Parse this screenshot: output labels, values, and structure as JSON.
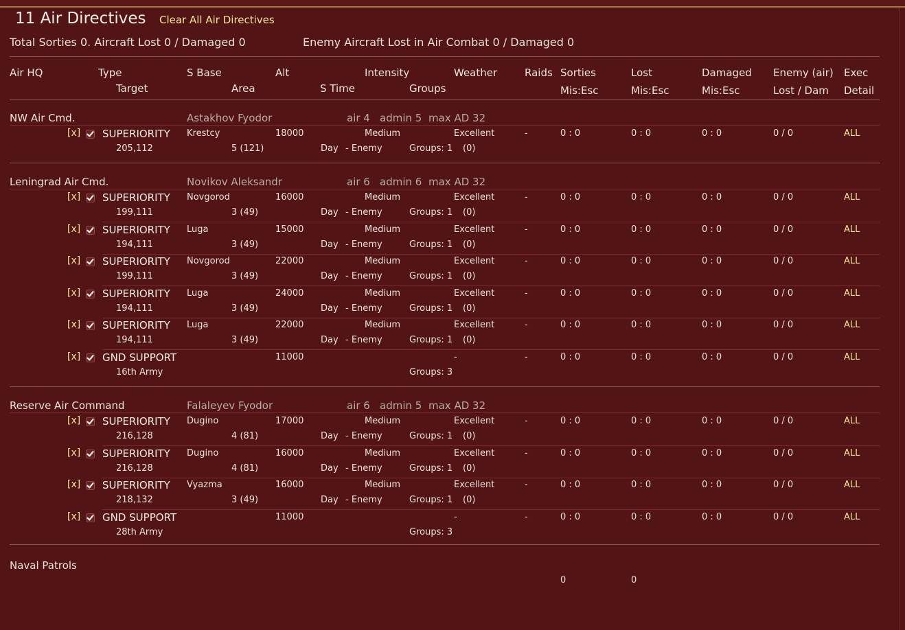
{
  "header": {
    "title": "11 Air Directives",
    "clear_link": "Clear All Air Directives",
    "summary_left": "Total Sorties 0. Aircraft Lost 0 / Damaged 0",
    "summary_right": "Enemy Aircraft Lost in Air Combat 0 / Damaged 0"
  },
  "columns": {
    "air_hq": "Air HQ",
    "type": "Type",
    "target": "Target",
    "s_base": "S Base",
    "area": "Area",
    "alt": "Alt",
    "s_time": "S Time",
    "intensity": "Intensity",
    "groups": "Groups",
    "weather": "Weather",
    "raids": "Raids",
    "sorties": "Sorties",
    "sorties_sub": "Mis:Esc",
    "lost": "Lost",
    "lost_sub": "Mis:Esc",
    "damaged": "Damaged",
    "damaged_sub": "Mis:Esc",
    "enemy": "Enemy (air)",
    "enemy_sub": "Lost / Dam",
    "exec": "Exec",
    "detail": "Detail"
  },
  "groups": [
    {
      "name": "NW Air Cmd.",
      "commander": "Astakhov Fyodor",
      "air": "air 4",
      "admin": "admin 5",
      "maxad": "max AD 32",
      "directives": [
        {
          "x": "[x]",
          "type": "SUPERIORITY",
          "target": "205,112",
          "base": "Krestcy",
          "area": "5 (121)",
          "alt": "18000",
          "time": "Day",
          "vs": "- Enemy",
          "intensity": "Medium",
          "groups": "Groups: 1",
          "groups_n": "(0)",
          "weather": "Excellent",
          "raids": "-",
          "sorties": "0 : 0",
          "lost": "0 : 0",
          "damaged": "0 : 0",
          "enemy": "0 / 0",
          "exec": "ALL"
        }
      ]
    },
    {
      "name": "Leningrad Air Cmd.",
      "commander": "Novikov Aleksandr",
      "air": "air 6",
      "admin": "admin 6",
      "maxad": "max AD 32",
      "directives": [
        {
          "x": "[x]",
          "type": "SUPERIORITY",
          "target": "199,111",
          "base": "Novgorod",
          "area": "3 (49)",
          "alt": "16000",
          "time": "Day",
          "vs": "- Enemy",
          "intensity": "Medium",
          "groups": "Groups: 1",
          "groups_n": "(0)",
          "weather": "Excellent",
          "raids": "-",
          "sorties": "0 : 0",
          "lost": "0 : 0",
          "damaged": "0 : 0",
          "enemy": "0 / 0",
          "exec": "ALL"
        },
        {
          "x": "[x]",
          "type": "SUPERIORITY",
          "target": "194,111",
          "base": "Luga",
          "area": "3 (49)",
          "alt": "15000",
          "time": "Day",
          "vs": "- Enemy",
          "intensity": "Medium",
          "groups": "Groups: 1",
          "groups_n": "(0)",
          "weather": "Excellent",
          "raids": "-",
          "sorties": "0 : 0",
          "lost": "0 : 0",
          "damaged": "0 : 0",
          "enemy": "0 / 0",
          "exec": "ALL"
        },
        {
          "x": "[x]",
          "type": "SUPERIORITY",
          "target": "199,111",
          "base": "Novgorod",
          "area": "3 (49)",
          "alt": "22000",
          "time": "Day",
          "vs": "- Enemy",
          "intensity": "Medium",
          "groups": "Groups: 1",
          "groups_n": "(0)",
          "weather": "Excellent",
          "raids": "-",
          "sorties": "0 : 0",
          "lost": "0 : 0",
          "damaged": "0 : 0",
          "enemy": "0 / 0",
          "exec": "ALL"
        },
        {
          "x": "[x]",
          "type": "SUPERIORITY",
          "target": "194,111",
          "base": "Luga",
          "area": "3 (49)",
          "alt": "24000",
          "time": "Day",
          "vs": "- Enemy",
          "intensity": "Medium",
          "groups": "Groups: 1",
          "groups_n": "(0)",
          "weather": "Excellent",
          "raids": "-",
          "sorties": "0 : 0",
          "lost": "0 : 0",
          "damaged": "0 : 0",
          "enemy": "0 / 0",
          "exec": "ALL"
        },
        {
          "x": "[x]",
          "type": "SUPERIORITY",
          "target": "194,111",
          "base": "Luga",
          "area": "3 (49)",
          "alt": "22000",
          "time": "Day",
          "vs": "- Enemy",
          "intensity": "Medium",
          "groups": "Groups: 1",
          "groups_n": "(0)",
          "weather": "Excellent",
          "raids": "-",
          "sorties": "0 : 0",
          "lost": "0 : 0",
          "damaged": "0 : 0",
          "enemy": "0 / 0",
          "exec": "ALL"
        },
        {
          "x": "[x]",
          "type": "GND SUPPORT",
          "target": "16th Army",
          "base": "",
          "area": "",
          "alt": "11000",
          "time": "",
          "vs": "",
          "intensity": "",
          "groups": "Groups: 3",
          "groups_n": "",
          "weather": "-",
          "raids": "-",
          "sorties": "0 : 0",
          "lost": "0 : 0",
          "damaged": "0 : 0",
          "enemy": "0 / 0",
          "exec": "ALL"
        }
      ]
    },
    {
      "name": "Reserve Air Command",
      "commander": "Falaleyev Fyodor",
      "air": "air 6",
      "admin": "admin 5",
      "maxad": "max AD 32",
      "directives": [
        {
          "x": "[x]",
          "type": "SUPERIORITY",
          "target": "216,128",
          "base": "Dugino",
          "area": "4 (81)",
          "alt": "17000",
          "time": "Day",
          "vs": "- Enemy",
          "intensity": "Medium",
          "groups": "Groups: 1",
          "groups_n": "(0)",
          "weather": "Excellent",
          "raids": "-",
          "sorties": "0 : 0",
          "lost": "0 : 0",
          "damaged": "0 : 0",
          "enemy": "0 / 0",
          "exec": "ALL"
        },
        {
          "x": "[x]",
          "type": "SUPERIORITY",
          "target": "216,128",
          "base": "Dugino",
          "area": "4 (81)",
          "alt": "16000",
          "time": "Day",
          "vs": "- Enemy",
          "intensity": "Medium",
          "groups": "Groups: 1",
          "groups_n": "(0)",
          "weather": "Excellent",
          "raids": "-",
          "sorties": "0 : 0",
          "lost": "0 : 0",
          "damaged": "0 : 0",
          "enemy": "0 / 0",
          "exec": "ALL"
        },
        {
          "x": "[x]",
          "type": "SUPERIORITY",
          "target": "218,132",
          "base": "Vyazma",
          "area": "3 (49)",
          "alt": "16000",
          "time": "Day",
          "vs": "- Enemy",
          "intensity": "Medium",
          "groups": "Groups: 1",
          "groups_n": "(0)",
          "weather": "Excellent",
          "raids": "-",
          "sorties": "0 : 0",
          "lost": "0 : 0",
          "damaged": "0 : 0",
          "enemy": "0 / 0",
          "exec": "ALL"
        },
        {
          "x": "[x]",
          "type": "GND SUPPORT",
          "target": "28th Army",
          "base": "",
          "area": "",
          "alt": "11000",
          "time": "",
          "vs": "",
          "intensity": "",
          "groups": "Groups: 3",
          "groups_n": "",
          "weather": "-",
          "raids": "-",
          "sorties": "0 : 0",
          "lost": "0 : 0",
          "damaged": "0 : 0",
          "enemy": "0 / 0",
          "exec": "ALL"
        }
      ]
    }
  ],
  "naval": {
    "label": "Naval Patrols",
    "sorties": "0",
    "lost": "0"
  }
}
